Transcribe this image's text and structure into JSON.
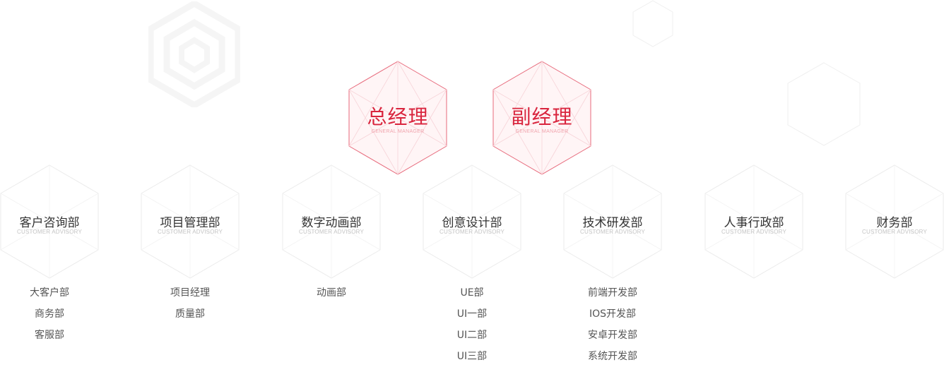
{
  "executives": [
    {
      "title": "总经理",
      "subtitle": "GENERAL MANAGER"
    },
    {
      "title": "副经理",
      "subtitle": "GENERAL MANAGER"
    }
  ],
  "departments": [
    {
      "title": "客户咨询部",
      "subtitle": "CUSTOMER ADVISORY",
      "subs": [
        "大客户部",
        "商务部",
        "客服部"
      ]
    },
    {
      "title": "项目管理部",
      "subtitle": "CUSTOMER ADVISORY",
      "subs": [
        "项目经理",
        "质量部"
      ]
    },
    {
      "title": "数字动画部",
      "subtitle": "CUSTOMER ADVISORY",
      "subs": [
        "动画部"
      ]
    },
    {
      "title": "创意设计部",
      "subtitle": "CUSTOMER ADVISORY",
      "subs": [
        "UE部",
        "UI一部",
        "UI二部",
        "UI三部"
      ]
    },
    {
      "title": "技术研发部",
      "subtitle": "CUSTOMER ADVISORY",
      "subs": [
        "前端开发部",
        "IOS开发部",
        "安卓开发部",
        "系统开发部"
      ]
    },
    {
      "title": "人事行政部",
      "subtitle": "CUSTOMER ADVISORY",
      "subs": []
    },
    {
      "title": "财务部",
      "subtitle": "CUSTOMER ADVISORY",
      "subs": []
    }
  ],
  "colors": {
    "accent": "#d9253e",
    "accent_light": "#f0a4ad",
    "hex_fill": "#fff5f6",
    "hex_line": "#ebebeb"
  }
}
